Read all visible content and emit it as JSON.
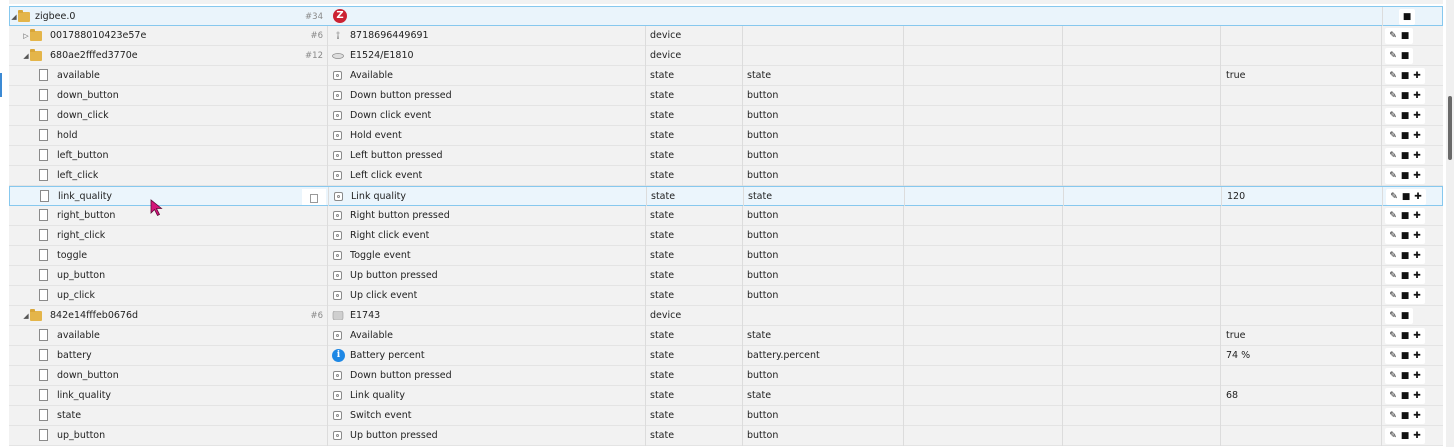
{
  "rows": [
    {
      "id": "zigbee.0",
      "count": "#34",
      "name": "",
      "role": "",
      "type": "",
      "value": "",
      "kind": "adapter",
      "level": 0,
      "expanded": true,
      "btns": [
        "delete"
      ]
    },
    {
      "id": "001788010423e57e",
      "count": "#6",
      "name": "8718696449691",
      "role": "device",
      "type": "",
      "value": "",
      "kind": "device",
      "level": 1,
      "expanded": false,
      "icon": "bulb-icon",
      "btns": [
        "edit",
        "delete"
      ]
    },
    {
      "id": "680ae2fffed3770e",
      "count": "#12",
      "name": "E1524/E1810",
      "role": "device",
      "type": "",
      "value": "",
      "kind": "device",
      "level": 1,
      "expanded": true,
      "icon": "remote-icon",
      "btns": [
        "edit",
        "delete"
      ]
    },
    {
      "id": "available",
      "name": "Available",
      "role": "state",
      "type": "state",
      "value": "true",
      "kind": "state",
      "level": 2,
      "btns": [
        "edit",
        "delete",
        "wrench"
      ]
    },
    {
      "id": "down_button",
      "name": "Down button pressed",
      "role": "state",
      "type": "button",
      "value": "",
      "kind": "state",
      "level": 2,
      "btns": [
        "edit",
        "delete",
        "wrench"
      ]
    },
    {
      "id": "down_click",
      "name": "Down click event",
      "role": "state",
      "type": "button",
      "value": "",
      "kind": "state",
      "level": 2,
      "btns": [
        "edit",
        "delete",
        "wrench"
      ]
    },
    {
      "id": "hold",
      "name": "Hold event",
      "role": "state",
      "type": "button",
      "value": "",
      "kind": "state",
      "level": 2,
      "btns": [
        "edit",
        "delete",
        "wrench"
      ]
    },
    {
      "id": "left_button",
      "name": "Left button pressed",
      "role": "state",
      "type": "button",
      "value": "",
      "kind": "state",
      "level": 2,
      "btns": [
        "edit",
        "delete",
        "wrench"
      ]
    },
    {
      "id": "left_click",
      "name": "Left click event",
      "role": "state",
      "type": "button",
      "value": "",
      "kind": "state",
      "level": 2,
      "btns": [
        "edit",
        "delete",
        "wrench"
      ]
    },
    {
      "id": "link_quality",
      "name": "Link quality",
      "role": "state",
      "type": "state",
      "value": "120",
      "kind": "state",
      "level": 2,
      "selected": true,
      "btns": [
        "edit",
        "delete",
        "wrench"
      ]
    },
    {
      "id": "right_button",
      "name": "Right button pressed",
      "role": "state",
      "type": "button",
      "value": "",
      "kind": "state",
      "level": 2,
      "btns": [
        "edit",
        "delete",
        "wrench"
      ]
    },
    {
      "id": "right_click",
      "name": "Right click event",
      "role": "state",
      "type": "button",
      "value": "",
      "kind": "state",
      "level": 2,
      "btns": [
        "edit",
        "delete",
        "wrench"
      ]
    },
    {
      "id": "toggle",
      "name": "Toggle event",
      "role": "state",
      "type": "button",
      "value": "",
      "kind": "state",
      "level": 2,
      "btns": [
        "edit",
        "delete",
        "wrench"
      ]
    },
    {
      "id": "up_button",
      "name": "Up button pressed",
      "role": "state",
      "type": "button",
      "value": "",
      "kind": "state",
      "level": 2,
      "btns": [
        "edit",
        "delete",
        "wrench"
      ]
    },
    {
      "id": "up_click",
      "name": "Up click event",
      "role": "state",
      "type": "button",
      "value": "",
      "kind": "state",
      "level": 2,
      "btns": [
        "edit",
        "delete",
        "wrench"
      ]
    },
    {
      "id": "842e14fffeb0676d",
      "count": "#6",
      "name": "E1743",
      "role": "device",
      "type": "",
      "value": "",
      "kind": "device",
      "level": 1,
      "expanded": true,
      "icon": "switch-icon",
      "btns": [
        "edit",
        "delete"
      ]
    },
    {
      "id": "available",
      "name": "Available",
      "role": "state",
      "type": "state",
      "value": "true",
      "kind": "state",
      "level": 2,
      "btns": [
        "edit",
        "delete",
        "wrench"
      ]
    },
    {
      "id": "battery",
      "name": "Battery percent",
      "role": "state",
      "type": "battery.percent",
      "value": "74 %",
      "kind": "state",
      "level": 2,
      "info": true,
      "btns": [
        "edit",
        "delete",
        "wrench"
      ]
    },
    {
      "id": "down_button",
      "name": "Down button pressed",
      "role": "state",
      "type": "button",
      "value": "",
      "kind": "state",
      "level": 2,
      "btns": [
        "edit",
        "delete",
        "wrench"
      ]
    },
    {
      "id": "link_quality",
      "name": "Link quality",
      "role": "state",
      "type": "state",
      "value": "68",
      "kind": "state",
      "level": 2,
      "btns": [
        "edit",
        "delete",
        "wrench"
      ]
    },
    {
      "id": "state",
      "name": "Switch event",
      "role": "state",
      "type": "button",
      "value": "",
      "kind": "state",
      "level": 2,
      "btns": [
        "edit",
        "delete",
        "wrench"
      ]
    },
    {
      "id": "up_button",
      "name": "Up button pressed",
      "role": "state",
      "type": "button",
      "value": "",
      "kind": "state",
      "level": 2,
      "btns": [
        "edit",
        "delete",
        "wrench"
      ]
    }
  ],
  "glyphs": {
    "expanded": "◢",
    "collapsed": "▷",
    "edit": "✎",
    "delete": "■",
    "wrench": "✚",
    "info": "i",
    "z_logo": "Z"
  },
  "colors": {
    "selection_border": "#87c8ee",
    "selection_bg": "#ebf5fc",
    "folder": "#e4b54a",
    "info_icon": "#1e88e5",
    "zigbee_logo": "#cc2233"
  }
}
